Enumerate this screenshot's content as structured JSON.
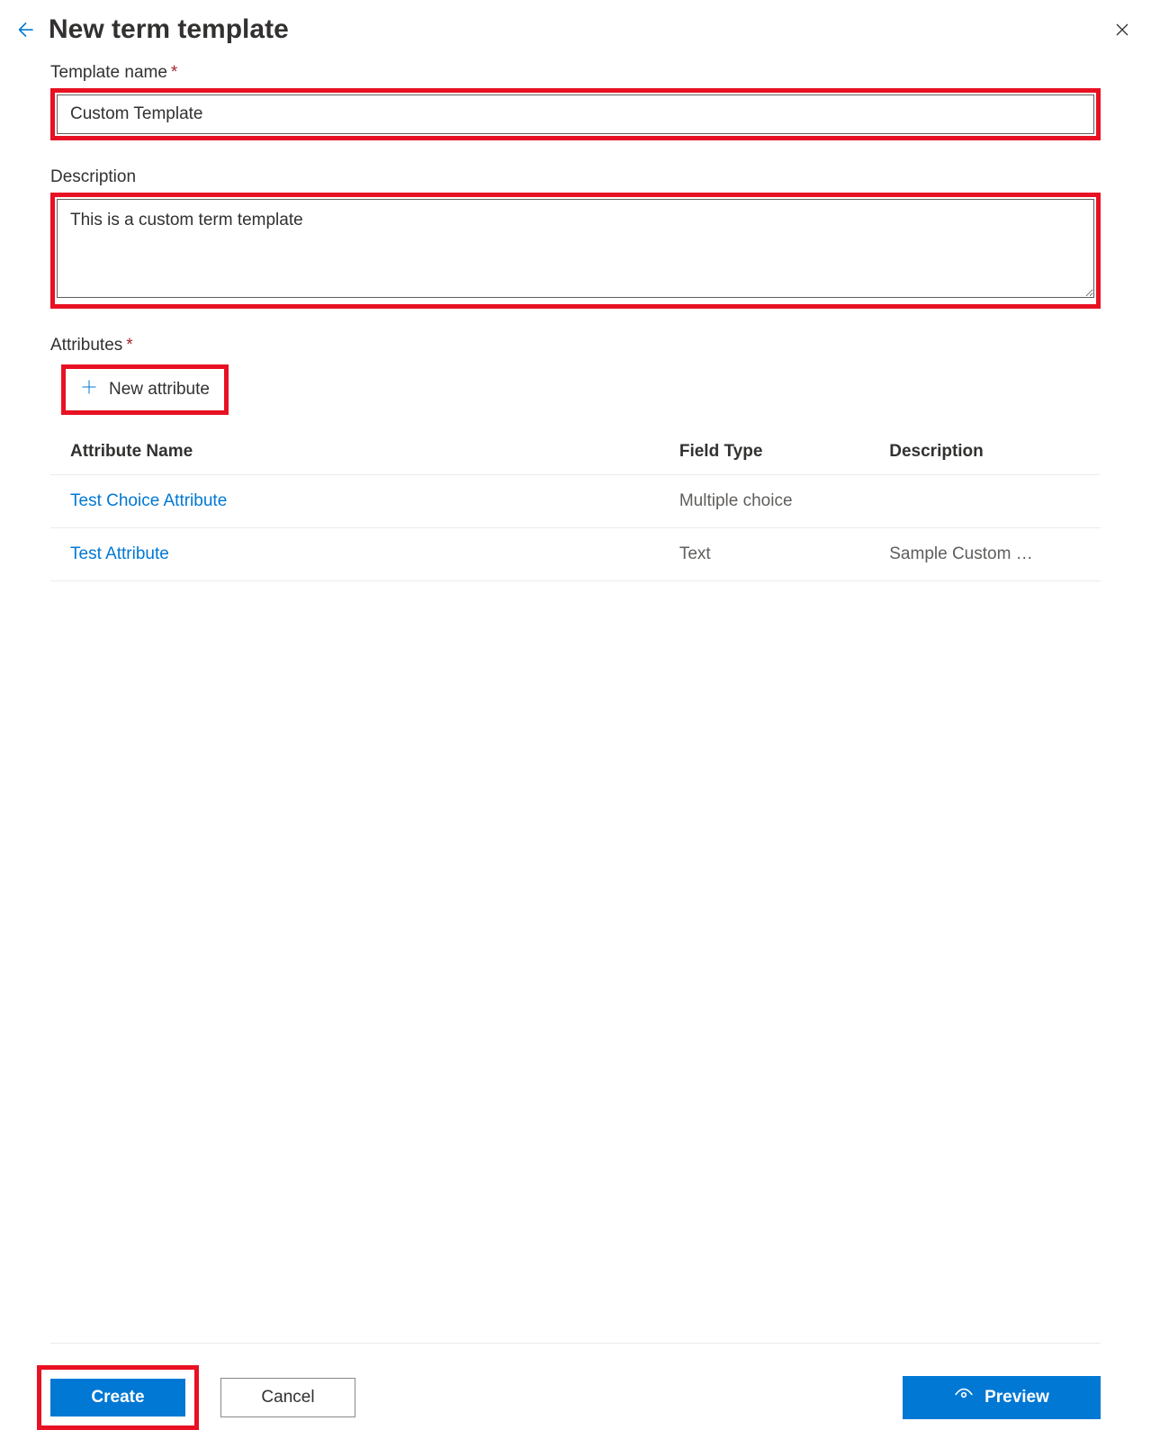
{
  "header": {
    "title": "New term template"
  },
  "fields": {
    "template_name": {
      "label": "Template name",
      "value": "Custom Template"
    },
    "description": {
      "label": "Description",
      "value": "This is a custom term template"
    },
    "attributes": {
      "label": "Attributes",
      "new_button": "New attribute"
    }
  },
  "table": {
    "headers": {
      "name": "Attribute Name",
      "type": "Field Type",
      "description": "Description"
    },
    "rows": [
      {
        "name": "Test Choice Attribute",
        "type": "Multiple choice",
        "description": ""
      },
      {
        "name": "Test Attribute",
        "type": "Text",
        "description": "Sample Custom …"
      }
    ]
  },
  "footer": {
    "create": "Create",
    "cancel": "Cancel",
    "preview": "Preview"
  }
}
